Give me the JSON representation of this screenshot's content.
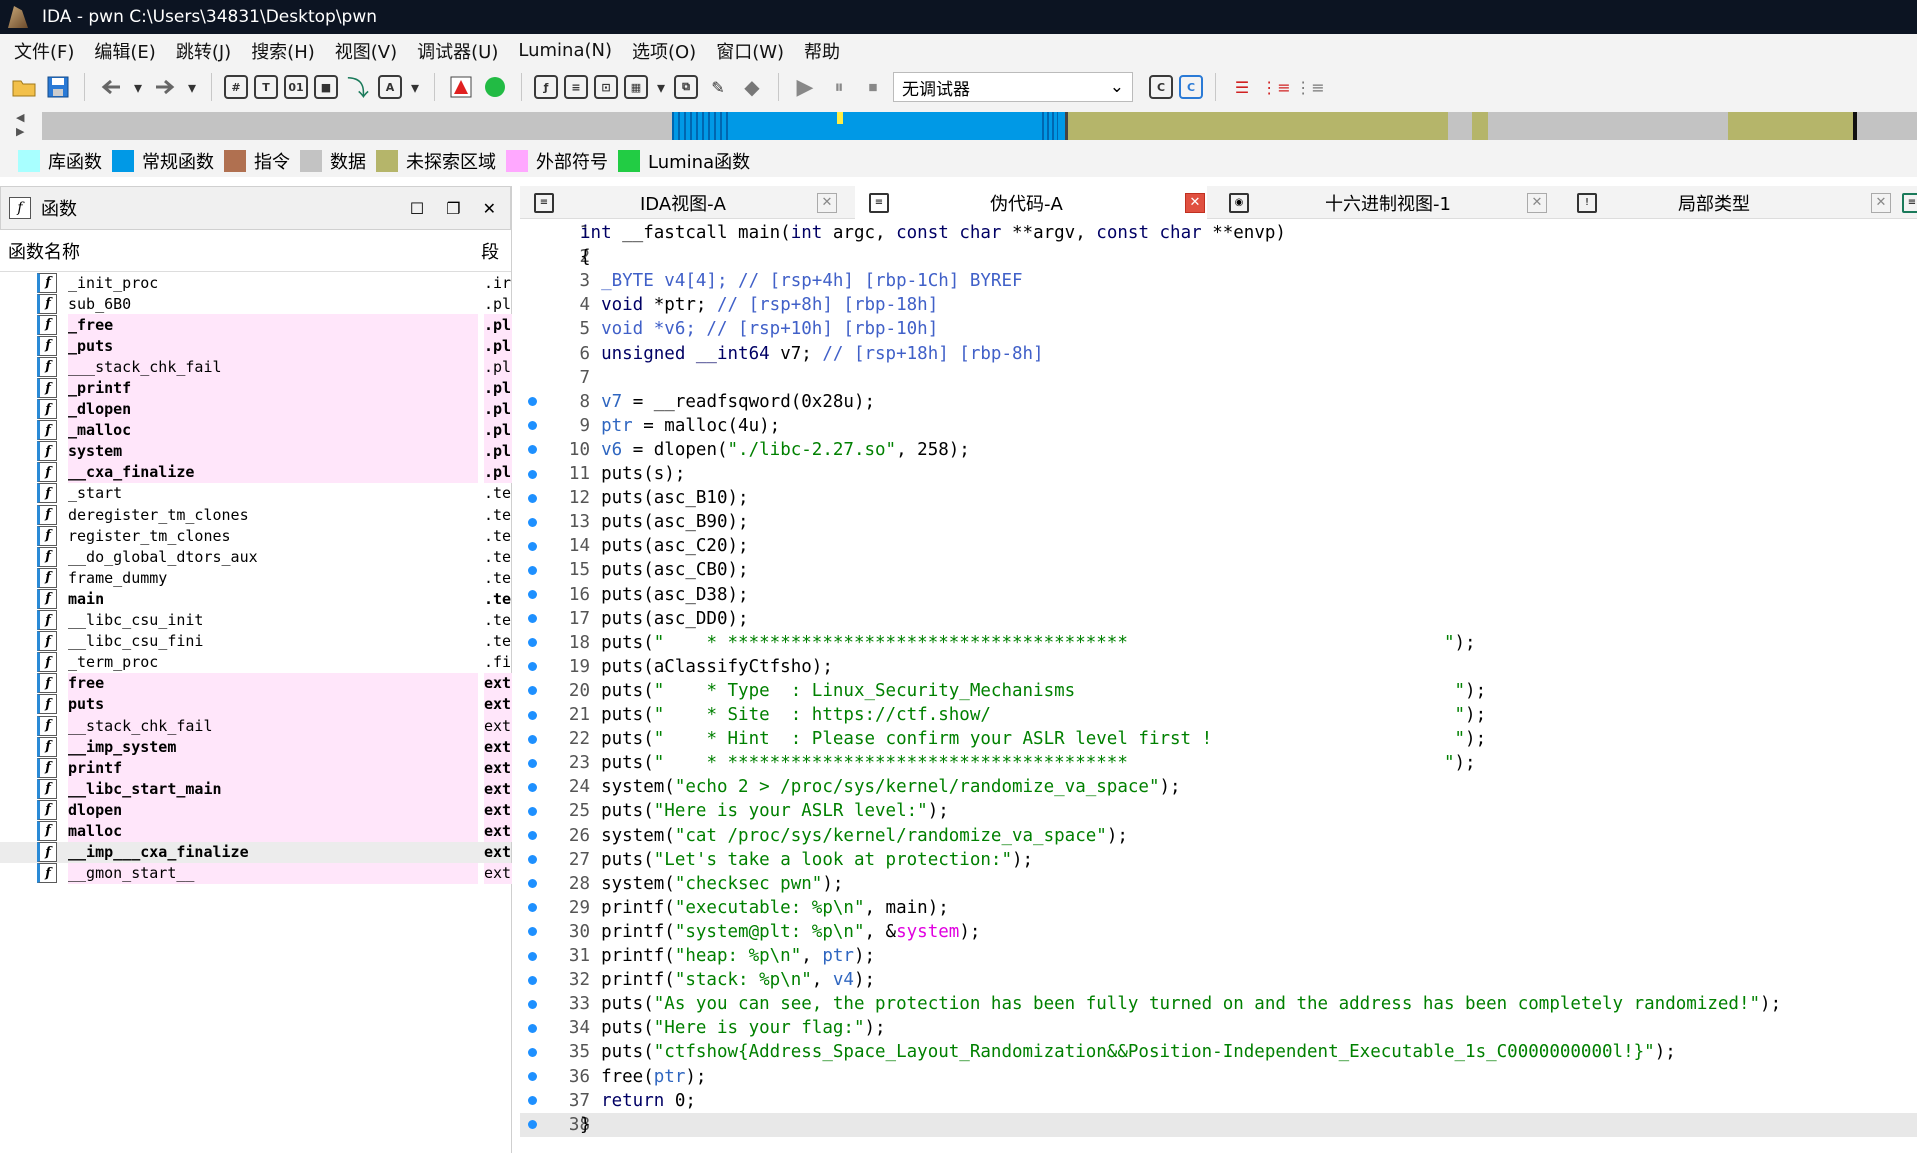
{
  "window": {
    "title": "IDA - pwn C:\\Users\\34831\\Desktop\\pwn"
  },
  "menu": [
    "文件(F)",
    "编辑(E)",
    "跳转(J)",
    "搜索(H)",
    "视图(V)",
    "调试器(U)",
    "Lumina(N)",
    "选项(O)",
    "窗口(W)",
    "帮助"
  ],
  "toolbar": {
    "debugger_select": "无调试器"
  },
  "legend": [
    {
      "label": "库函数",
      "color": "#a8ffff"
    },
    {
      "label": "常规函数",
      "color": "#0099e6"
    },
    {
      "label": "指令",
      "color": "#b07050"
    },
    {
      "label": "数据",
      "color": "#c3c3c3"
    },
    {
      "label": "未探索区域",
      "color": "#b5b56a"
    },
    {
      "label": "外部符号",
      "color": "#ffa8ff"
    },
    {
      "label": "Lumina函数",
      "color": "#22cc44"
    }
  ],
  "functions_panel": {
    "title": "函数",
    "col_name": "函数名称",
    "col_segment": "段",
    "rows": [
      {
        "name": "_init_proc",
        "seg": ".ir",
        "lib": false,
        "bold": false
      },
      {
        "name": "sub_6B0",
        "seg": ".pl",
        "lib": false,
        "bold": false
      },
      {
        "name": "_free",
        "seg": ".pl",
        "lib": true,
        "bold": true
      },
      {
        "name": "_puts",
        "seg": ".pl",
        "lib": true,
        "bold": true
      },
      {
        "name": "___stack_chk_fail",
        "seg": ".pl",
        "lib": true,
        "bold": false
      },
      {
        "name": "_printf",
        "seg": ".pl",
        "lib": true,
        "bold": true
      },
      {
        "name": "_dlopen",
        "seg": ".pl",
        "lib": true,
        "bold": true
      },
      {
        "name": "_malloc",
        "seg": ".pl",
        "lib": true,
        "bold": true
      },
      {
        "name": "system",
        "seg": ".pl",
        "lib": true,
        "bold": true
      },
      {
        "name": "__cxa_finalize",
        "seg": ".pl",
        "lib": true,
        "bold": true
      },
      {
        "name": "_start",
        "seg": ".te",
        "lib": false,
        "bold": false
      },
      {
        "name": "deregister_tm_clones",
        "seg": ".te",
        "lib": false,
        "bold": false
      },
      {
        "name": "register_tm_clones",
        "seg": ".te",
        "lib": false,
        "bold": false
      },
      {
        "name": "__do_global_dtors_aux",
        "seg": ".te",
        "lib": false,
        "bold": false
      },
      {
        "name": "frame_dummy",
        "seg": ".te",
        "lib": false,
        "bold": false
      },
      {
        "name": "main",
        "seg": ".te",
        "lib": false,
        "bold": true
      },
      {
        "name": "__libc_csu_init",
        "seg": ".te",
        "lib": false,
        "bold": false
      },
      {
        "name": "__libc_csu_fini",
        "seg": ".te",
        "lib": false,
        "bold": false
      },
      {
        "name": "_term_proc",
        "seg": ".fi",
        "lib": false,
        "bold": false
      },
      {
        "name": "free",
        "seg": "ext",
        "lib": true,
        "bold": true
      },
      {
        "name": "puts",
        "seg": "ext",
        "lib": true,
        "bold": true
      },
      {
        "name": "__stack_chk_fail",
        "seg": "ext",
        "lib": true,
        "bold": false
      },
      {
        "name": "__imp_system",
        "seg": "ext",
        "lib": true,
        "bold": true
      },
      {
        "name": "printf",
        "seg": "ext",
        "lib": true,
        "bold": true
      },
      {
        "name": "__libc_start_main",
        "seg": "ext",
        "lib": true,
        "bold": true
      },
      {
        "name": "dlopen",
        "seg": "ext",
        "lib": true,
        "bold": true
      },
      {
        "name": "malloc",
        "seg": "ext",
        "lib": true,
        "bold": true
      },
      {
        "name": "__imp___cxa_finalize",
        "seg": "ext",
        "lib": false,
        "bold": true,
        "selected": true
      },
      {
        "name": "__gmon_start__",
        "seg": "ext",
        "lib": true,
        "bold": false
      }
    ]
  },
  "tabs": [
    {
      "label": "IDA视图-A",
      "active": false
    },
    {
      "label": "伪代码-A",
      "active": true
    },
    {
      "label": "十六进制视图-1",
      "active": false
    },
    {
      "label": "局部类型",
      "active": false
    }
  ],
  "code": [
    {
      "n": "1",
      "dot": false,
      "html": "<span class='k'>int</span> __fastcall main(<span class='k'>int</span> argc, <span class='k'>const char</span> **argv, <span class='k'>const char</span> **envp)"
    },
    {
      "n": "2",
      "dot": false,
      "html": "{"
    },
    {
      "n": "3",
      "dot": false,
      "html": "  <span class='c'>_BYTE v4[4]; // [rsp+4h] [rbp-1Ch] BYREF</span>"
    },
    {
      "n": "4",
      "dot": false,
      "html": "  <span class='k'>void</span> *ptr; <span class='c'>// [rsp+8h] [rbp-18h]</span>"
    },
    {
      "n": "5",
      "dot": false,
      "html": "  <span class='c'>void *v6; // [rsp+10h] [rbp-10h]</span>"
    },
    {
      "n": "6",
      "dot": false,
      "html": "  <span class='k'>unsigned __int64</span> v7; <span class='c'>// [rsp+18h] [rbp-8h]</span>"
    },
    {
      "n": "7",
      "dot": false,
      "html": ""
    },
    {
      "n": "8",
      "dot": true,
      "html": "  <span class='v'>v7</span> = __readfsqword(0x28u);"
    },
    {
      "n": "9",
      "dot": true,
      "html": "  <span class='v'>ptr</span> = malloc(4u);"
    },
    {
      "n": "10",
      "dot": true,
      "html": "  <span class='v'>v6</span> = dlopen(<span class='s'>\"./libc-2.27.so\"</span>, 258);"
    },
    {
      "n": "11",
      "dot": true,
      "html": "  puts(s);"
    },
    {
      "n": "12",
      "dot": true,
      "html": "  puts(asc_B10);"
    },
    {
      "n": "13",
      "dot": true,
      "html": "  puts(asc_B90);"
    },
    {
      "n": "14",
      "dot": true,
      "html": "  puts(asc_C20);"
    },
    {
      "n": "15",
      "dot": true,
      "html": "  puts(asc_CB0);"
    },
    {
      "n": "16",
      "dot": true,
      "html": "  puts(asc_D38);"
    },
    {
      "n": "17",
      "dot": true,
      "html": "  puts(asc_DD0);"
    },
    {
      "n": "18",
      "dot": true,
      "html": "  puts(<span class='s'>\"    * **************************************                              \"</span>);"
    },
    {
      "n": "19",
      "dot": true,
      "html": "  puts(aClassifyCtfsho);"
    },
    {
      "n": "20",
      "dot": true,
      "html": "  puts(<span class='s'>\"    * Type  : Linux_Security_Mechanisms                                    \"</span>);"
    },
    {
      "n": "21",
      "dot": true,
      "html": "  puts(<span class='s'>\"    * Site  : https://ctf.show/                                            \"</span>);"
    },
    {
      "n": "22",
      "dot": true,
      "html": "  puts(<span class='s'>\"    * Hint  : Please confirm your ASLR level first !                       \"</span>);"
    },
    {
      "n": "23",
      "dot": true,
      "html": "  puts(<span class='s'>\"    * **************************************                              \"</span>);"
    },
    {
      "n": "24",
      "dot": true,
      "html": "  system(<span class='s'>\"echo 2 &gt; /proc/sys/kernel/randomize_va_space\"</span>);"
    },
    {
      "n": "25",
      "dot": true,
      "html": "  puts(<span class='s'>\"Here is your ASLR level:\"</span>);"
    },
    {
      "n": "26",
      "dot": true,
      "html": "  system(<span class='s'>\"cat /proc/sys/kernel/randomize_va_space\"</span>);"
    },
    {
      "n": "27",
      "dot": true,
      "html": "  puts(<span class='s'>\"Let's take a look at protection:\"</span>);"
    },
    {
      "n": "28",
      "dot": true,
      "html": "  system(<span class='s'>\"checksec pwn\"</span>);"
    },
    {
      "n": "29",
      "dot": true,
      "html": "  printf(<span class='s'>\"executable: %p\\n\"</span>, main);"
    },
    {
      "n": "30",
      "dot": true,
      "html": "  printf(<span class='s'>\"system@plt: %p\\n\"</span>, &amp;<span class='m'>system</span>);"
    },
    {
      "n": "31",
      "dot": true,
      "html": "  printf(<span class='s'>\"heap: %p\\n\"</span>, <span class='v'>ptr</span>);"
    },
    {
      "n": "32",
      "dot": true,
      "html": "  printf(<span class='s'>\"stack: %p\\n\"</span>, <span class='v'>v4</span>);"
    },
    {
      "n": "33",
      "dot": true,
      "html": "  puts(<span class='s'>\"As you can see, the protection has been fully turned on and the address has been completely randomized!\"</span>);"
    },
    {
      "n": "34",
      "dot": true,
      "html": "  puts(<span class='s'>\"Here is your flag:\"</span>);"
    },
    {
      "n": "35",
      "dot": true,
      "html": "  puts(<span class='s'>\"ctfshow{Address_Space_Layout_Randomization&amp;&amp;Position-Independent_Executable_1s_C0000000000l!}\"</span>);"
    },
    {
      "n": "36",
      "dot": true,
      "html": "  free(<span class='v'>ptr</span>);"
    },
    {
      "n": "37",
      "dot": true,
      "html": "  <span class='k'>return</span> 0;"
    },
    {
      "n": "38",
      "dot": true,
      "html": "}",
      "current": true
    }
  ]
}
